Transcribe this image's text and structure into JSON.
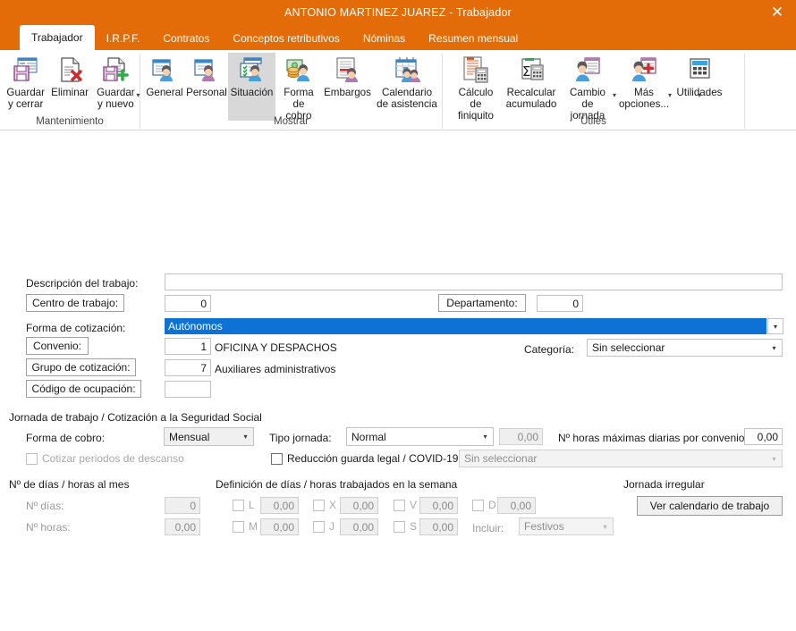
{
  "window": {
    "title": "ANTONIO MARTINEZ JUAREZ - Trabajador",
    "close_label": "✕",
    "accent_color": "#E36C09",
    "selection_color": "#0d72d4"
  },
  "tabs": [
    {
      "label": "Trabajador",
      "active": true
    },
    {
      "label": "I.R.P.F.",
      "active": false
    },
    {
      "label": "Contratos",
      "active": false
    },
    {
      "label": "Conceptos retributivos",
      "active": false
    },
    {
      "label": "Nóminas",
      "active": false
    },
    {
      "label": "Resumen mensual",
      "active": false
    }
  ],
  "ribbon": {
    "groups": [
      {
        "title": "Mantenimiento",
        "buttons": [
          {
            "label": "Guardar\ny cerrar",
            "icon": "save-close-icon",
            "selected": false,
            "dropdown": false
          },
          {
            "label": "Eliminar",
            "icon": "delete-document-icon",
            "selected": false,
            "dropdown": false
          },
          {
            "label": "Guardar\ny nuevo",
            "icon": "save-new-icon",
            "selected": false,
            "dropdown": true
          }
        ]
      },
      {
        "title": "Mostrar",
        "buttons": [
          {
            "label": "General",
            "icon": "general-person-icon",
            "selected": false,
            "dropdown": false
          },
          {
            "label": "Personal",
            "icon": "personal-person-icon",
            "selected": false,
            "dropdown": false
          },
          {
            "label": "Situación",
            "icon": "situacion-person-icon",
            "selected": true,
            "dropdown": false
          },
          {
            "label": "Forma\nde cobro",
            "icon": "payment-coins-icon",
            "selected": false,
            "dropdown": false
          },
          {
            "label": "Embargos",
            "icon": "embargo-list-icon",
            "selected": false,
            "dropdown": false
          },
          {
            "label": "Calendario\nde asistencia",
            "icon": "attendance-calendar-icon",
            "selected": false,
            "dropdown": false
          }
        ]
      },
      {
        "title": "Útiles",
        "buttons": [
          {
            "label": "Cálculo de\nfiniquito",
            "icon": "settlement-calc-icon",
            "selected": false,
            "dropdown": false
          },
          {
            "label": "Recalcular\nacumulado",
            "icon": "sigma-recalc-icon",
            "selected": false,
            "dropdown": false
          },
          {
            "label": "Cambio de\njornada",
            "icon": "shift-change-icon",
            "selected": false,
            "dropdown": true
          },
          {
            "label": "Más\nopciones...",
            "icon": "more-options-icon",
            "selected": false,
            "dropdown": true
          },
          {
            "label": "Utilidades",
            "icon": "calculator-icon",
            "selected": false,
            "dropdown": true
          }
        ]
      }
    ]
  },
  "form": {
    "descripcion_label": "Descripción del trabajo:",
    "descripcion_value": "",
    "centro_button": "Centro de trabajo:",
    "centro_value": "0",
    "departamento_button": "Departamento:",
    "departamento_value": "0",
    "forma_cotizacion_label": "Forma de cotización:",
    "forma_cotizacion_value": "Autónomos",
    "convenio_button": "Convenio:",
    "convenio_code": "1",
    "convenio_name": "OFICINA Y DESPACHOS",
    "categoria_label": "Categoría:",
    "categoria_value": "Sin seleccionar",
    "grupo_button": "Grupo de cotización:",
    "grupo_code": "7",
    "grupo_name": "Auxiliares administrativos",
    "codigo_ocupacion_button": "Código de ocupación:",
    "codigo_ocupacion_value": "",
    "jornada_section": "Jornada de trabajo / Cotización a la Seguridad Social",
    "forma_cobro_label": "Forma de cobro:",
    "forma_cobro_value": "Mensual",
    "tipo_jornada_label": "Tipo jornada:",
    "tipo_jornada_value": "Normal",
    "tipo_jornada_num": "0,00",
    "horas_max_label": "Nº horas máximas diarias por convenio:",
    "horas_max_value": "0,00",
    "cotizar_descanso_label": "Cotizar periodos de descanso",
    "cotizar_descanso_checked": false,
    "reduccion_label": "Reducción guarda legal / COVID-19",
    "reduccion_checked": false,
    "reduccion_value": "Sin seleccionar",
    "dias_horas_section": "Nº de días / horas al mes",
    "n_dias_label": "Nº días:",
    "n_dias_value": "0",
    "n_horas_label": "Nº horas:",
    "n_horas_value": "0,00",
    "definicion_section": "Definición de días / horas trabajados en la semana",
    "weekdays": [
      {
        "letter": "L",
        "value": "0,00",
        "checked": false
      },
      {
        "letter": "M",
        "value": "0,00",
        "checked": false
      },
      {
        "letter": "X",
        "value": "0,00",
        "checked": false
      },
      {
        "letter": "J",
        "value": "0,00",
        "checked": false
      },
      {
        "letter": "V",
        "value": "0,00",
        "checked": false
      },
      {
        "letter": "S",
        "value": "0,00",
        "checked": false
      },
      {
        "letter": "D",
        "value": "0,00",
        "checked": false
      }
    ],
    "incluir_label": "Incluir:",
    "incluir_value": "Festivos",
    "jornada_irregular_section": "Jornada irregular",
    "ver_calendario_button": "Ver calendario de trabajo"
  }
}
